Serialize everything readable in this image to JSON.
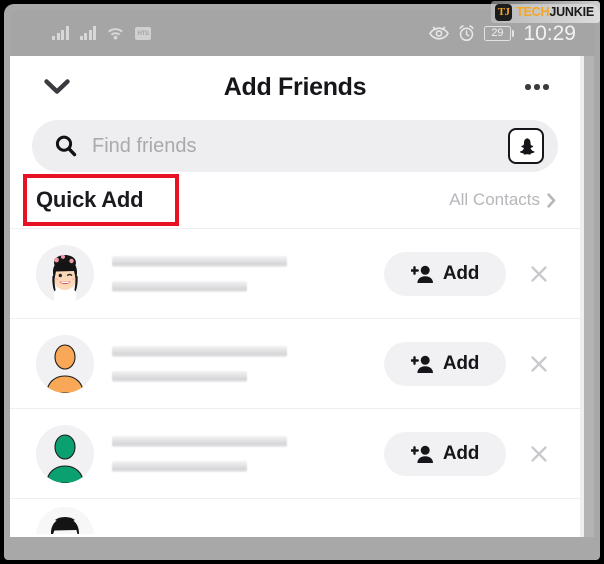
{
  "watermark": {
    "badge_text": "TJ",
    "brand_first": "TECH",
    "brand_second": "JUNKIE",
    "brand_color": "#f5a623",
    "badge_bg": "#1c1c1c"
  },
  "status_bar": {
    "signal_1_icon": "signal-bars-icon",
    "signal_2_icon": "signal-bars-icon",
    "wifi_icon": "wifi-icon",
    "hd_label": "HTS",
    "eye_icon": "eye-icon",
    "alarm_icon": "alarm-clock-icon",
    "battery_percent": "29",
    "time": "10:29"
  },
  "header": {
    "title": "Add Friends",
    "back_icon": "chevron-down-icon",
    "more_icon": "more-options-icon"
  },
  "search": {
    "placeholder": "Find friends",
    "value": "",
    "search_icon": "search-icon",
    "snapcode_icon": "snapchat-ghost-icon"
  },
  "section": {
    "title": "Quick Add",
    "all_contacts_label": "All Contacts",
    "all_contacts_chevron": "chevron-right-icon",
    "annotation_color": "#e81123"
  },
  "friends": [
    {
      "avatar_type": "bitmoji-beanie",
      "avatar_color": "#1a1a1a",
      "name_redacted": true,
      "add_label": "Add",
      "add_icon": "add-person-icon",
      "dismiss_icon": "close-icon"
    },
    {
      "avatar_type": "silhouette",
      "avatar_color": "#f9a857",
      "name_redacted": true,
      "add_label": "Add",
      "add_icon": "add-person-icon",
      "dismiss_icon": "close-icon"
    },
    {
      "avatar_type": "silhouette",
      "avatar_color": "#0ba06f",
      "name_redacted": true,
      "add_label": "Add",
      "add_icon": "add-person-icon",
      "dismiss_icon": "close-icon"
    }
  ],
  "partial_row": {
    "avatar_type": "bitmoji-dark-hair",
    "avatar_color": "#1a1a1a"
  }
}
